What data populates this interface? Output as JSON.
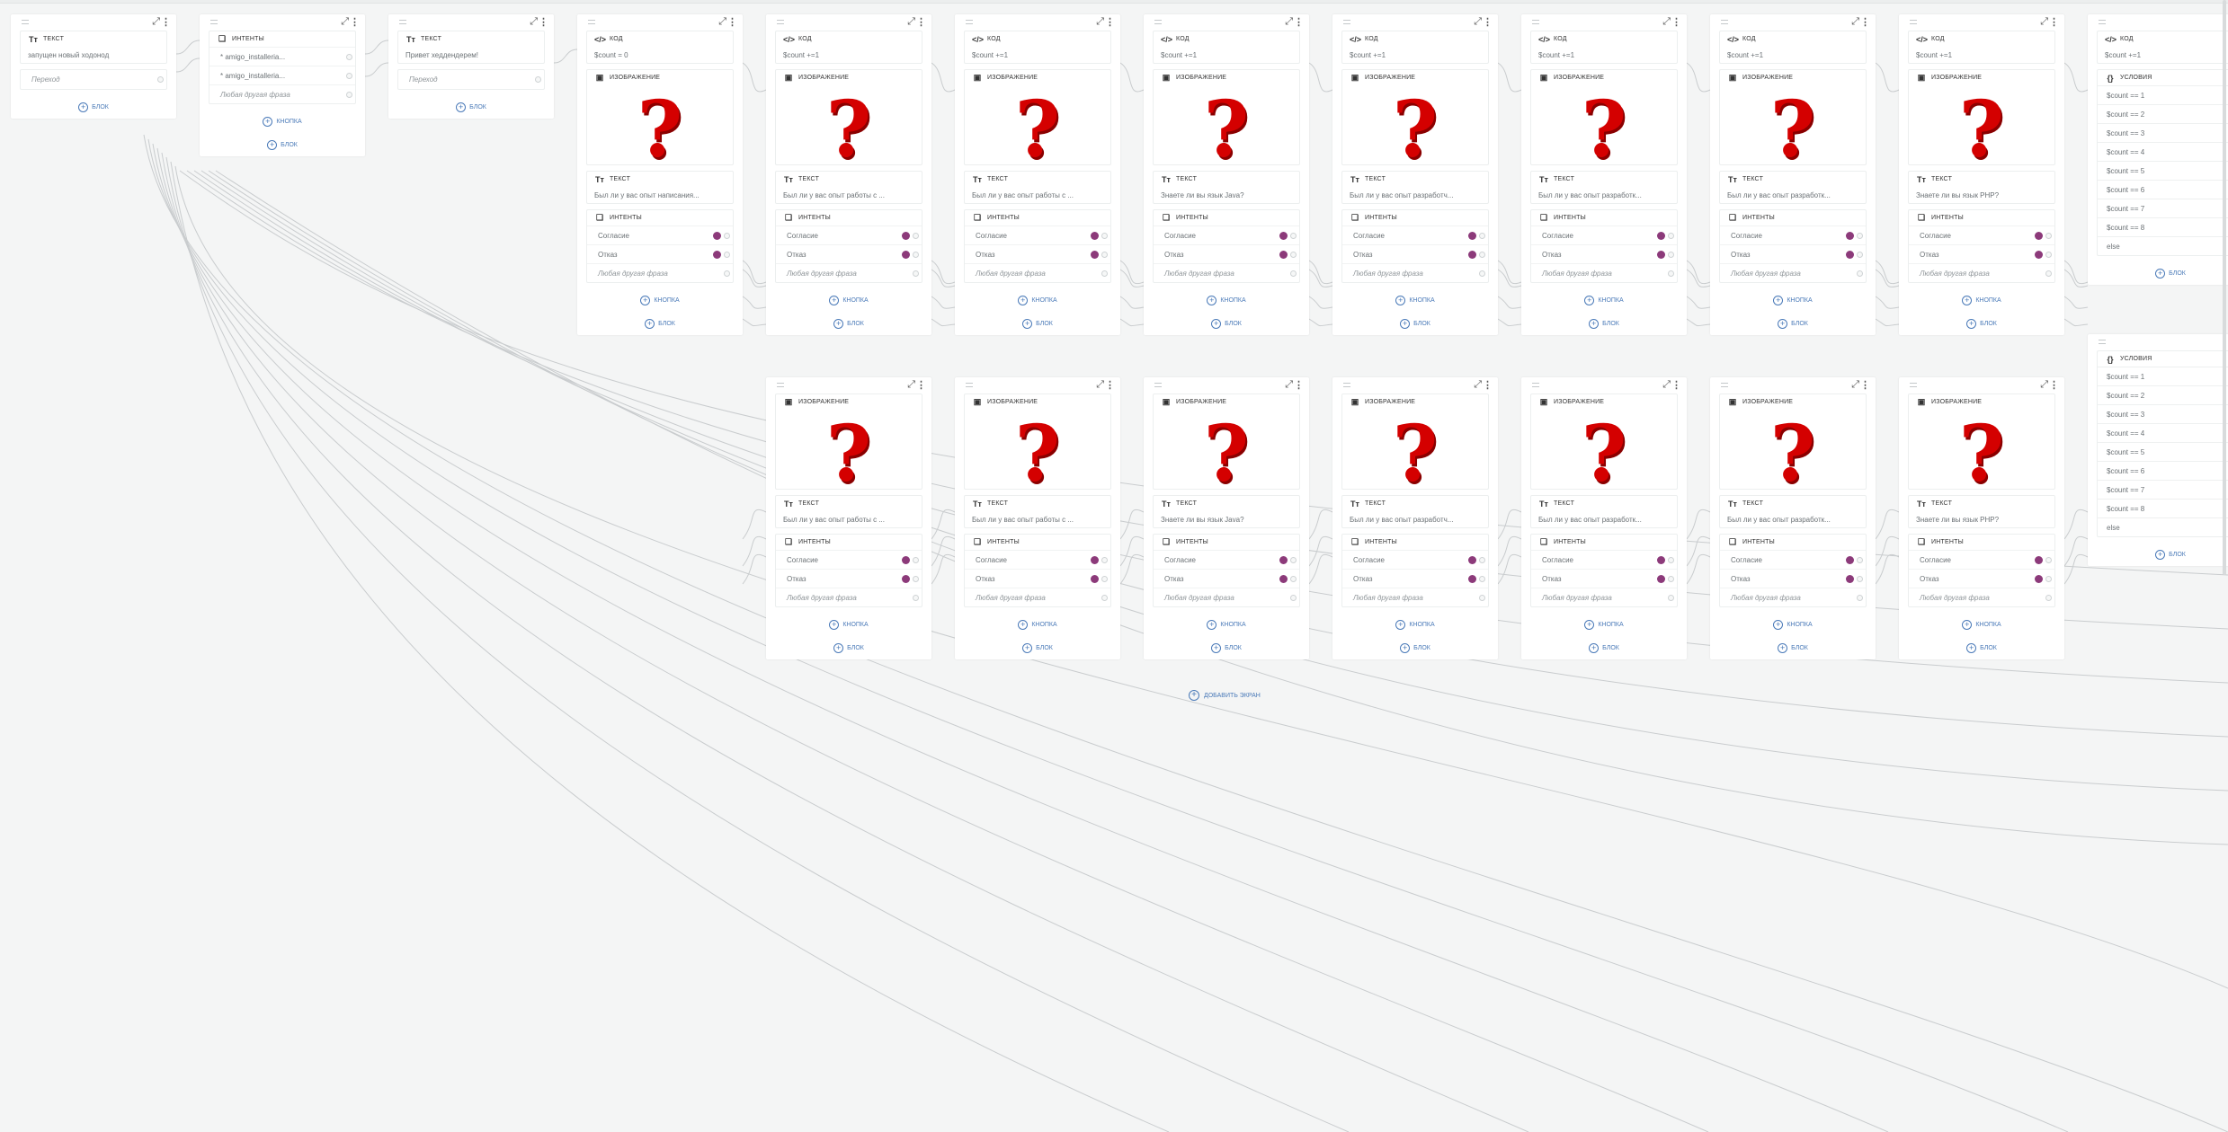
{
  "labels": {
    "text": "ТЕКСТ",
    "intents": "ИНТЕНТЫ",
    "code": "КОД",
    "image": "ИЗОБРАЖЕНИЕ",
    "conditions": "УСЛОВИЯ",
    "add_block": "БЛОК",
    "add_button": "КНОПКА",
    "add_screen": "ДОБАВИТЬ ЭКРАН",
    "transition": "Переход",
    "any_phrase": "Любая другая фраза",
    "agree": "Согласие",
    "refuse": "Отказ"
  },
  "icons": {
    "text": "text-icon",
    "intents": "intents-icon",
    "code": "code-icon",
    "image": "image-icon",
    "conditions": "braces-icon"
  },
  "colors": {
    "badge": "#8c3a7a",
    "link": "#4a7ab8",
    "question_mark": "#d40000"
  },
  "screens": {
    "start": {
      "text": "запущен новый ходонод"
    },
    "router": {
      "intents": [
        "* amigo_installeria...",
        "* amigo_installeria..."
      ]
    },
    "greet": {
      "text": "Привет хеддендерем!"
    },
    "column_top": [
      {
        "code": "$count = 0",
        "question": "Был ли у вас опыт написания..."
      },
      {
        "code": "$count +=1",
        "question": "Был ли у вас опыт работы с ..."
      },
      {
        "code": "$count +=1",
        "question": "Был ли у вас опыт работы с ..."
      },
      {
        "code": "$count +=1",
        "question": "Знаете ли вы язык Java?"
      },
      {
        "code": "$count +=1",
        "question": "Был ли у вас опыт разработч..."
      },
      {
        "code": "$count +=1",
        "question": "Был ли у вас опыт разработк..."
      },
      {
        "code": "$count +=1",
        "question": "Был ли у вас опыт разработк..."
      },
      {
        "code": "$count +=1",
        "question": "Знаете ли вы язык PHP?"
      }
    ],
    "column_bottom": [
      {
        "question": "Был ли у вас опыт работы с ..."
      },
      {
        "question": "Был ли у вас опыт работы с ..."
      },
      {
        "question": "Знаете ли вы язык Java?"
      },
      {
        "question": "Был ли у вас опыт разработч..."
      },
      {
        "question": "Был ли у вас опыт разработк..."
      },
      {
        "question": "Был ли у вас опыт разработк..."
      },
      {
        "question": "Знаете ли вы язык PHP?"
      }
    ],
    "final_top": {
      "code": "$count +=1",
      "conditions": [
        "$count == 1",
        "$count == 2",
        "$count == 3",
        "$count == 4",
        "$count == 5",
        "$count == 6",
        "$count == 7",
        "$count == 8",
        "else"
      ]
    },
    "final_bottom": {
      "conditions": [
        "$count == 1",
        "$count == 2",
        "$count == 3",
        "$count == 4",
        "$count == 5",
        "$count == 6",
        "$count == 7",
        "$count == 8",
        "else"
      ]
    }
  }
}
